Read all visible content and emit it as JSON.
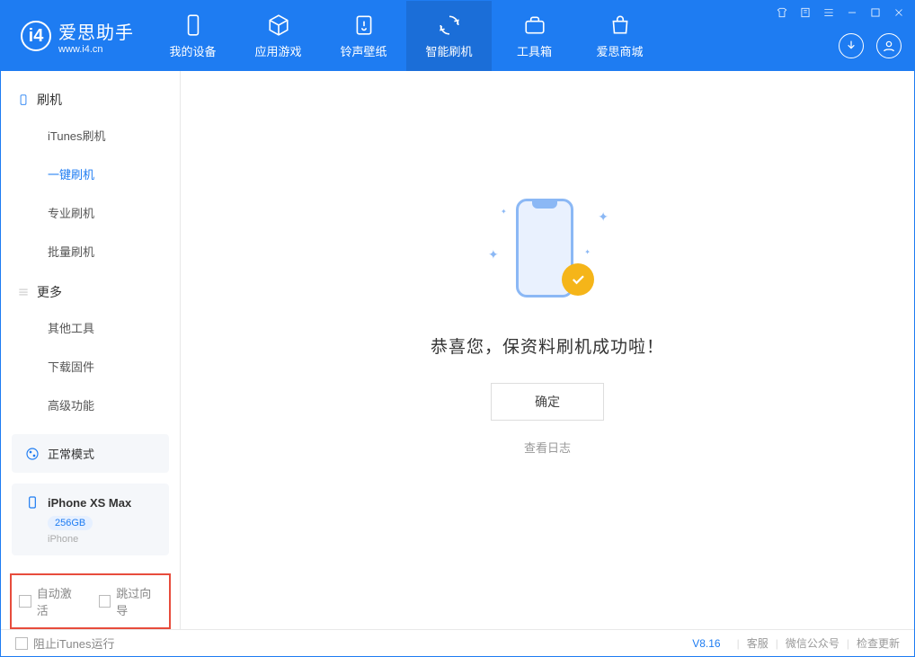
{
  "app": {
    "title": "爱思助手",
    "url": "www.i4.cn"
  },
  "tabs": {
    "device": "我的设备",
    "apps": "应用游戏",
    "ring": "铃声壁纸",
    "flash": "智能刷机",
    "tools": "工具箱",
    "shop": "爱思商城"
  },
  "sidebar": {
    "cat_flash": "刷机",
    "itunes_flash": "iTunes刷机",
    "one_click": "一键刷机",
    "pro_flash": "专业刷机",
    "batch_flash": "批量刷机",
    "cat_more": "更多",
    "other_tools": "其他工具",
    "download_fw": "下载固件",
    "advanced": "高级功能"
  },
  "device": {
    "mode": "正常模式",
    "name": "iPhone XS Max",
    "storage": "256GB",
    "type": "iPhone"
  },
  "options": {
    "auto_activate": "自动激活",
    "skip_guide": "跳过向导"
  },
  "main": {
    "success_text": "恭喜您，保资料刷机成功啦！",
    "ok_button": "确定",
    "view_log": "查看日志"
  },
  "footer": {
    "block_itunes": "阻止iTunes运行",
    "version": "V8.16",
    "support": "客服",
    "wechat": "微信公众号",
    "check_update": "检查更新"
  }
}
